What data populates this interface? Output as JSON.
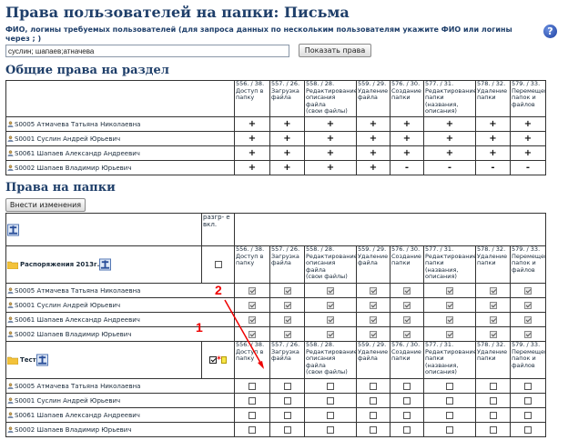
{
  "page_title": "Права пользователей на папки: Письма",
  "search": {
    "description": "ФИО, логины требуемых пользователей (для запроса данных по нескольким пользователям укажите ФИО или логины через ; )",
    "value": "суслин; шапаев;атначева",
    "button": "Показать права"
  },
  "general_section": {
    "title": "Общие права на раздел",
    "columns": [
      [
        "556. / 38.",
        "Доступ в",
        "папку"
      ],
      [
        "557. / 26.",
        "Загрузка",
        "файла"
      ],
      [
        "558. / 28.",
        "Редактирование",
        "описания файла",
        "(свои файлы)"
      ],
      [
        "559. / 29.",
        "Удаление",
        "файла"
      ],
      [
        "576. / 30.",
        "Создание",
        "папки"
      ],
      [
        "577. / 31.",
        "Редактирование",
        "папки (названия,",
        "описания)"
      ],
      [
        "578. / 32.",
        "Удаление",
        "папки"
      ],
      [
        "579. / 33.",
        "Перемещение",
        "папок и",
        "файлов"
      ]
    ],
    "rows": [
      {
        "user": "S0005 Атмачева Татьяна Николаевна",
        "cells": [
          "+",
          "+",
          "+",
          "+",
          "+",
          "+",
          "+",
          "+"
        ]
      },
      {
        "user": "S0001 Суслин Андрей Юрьевич",
        "cells": [
          "+",
          "+",
          "+",
          "+",
          "+",
          "+",
          "+",
          "+"
        ]
      },
      {
        "user": "S0061 Шапаев Александр Андреевич",
        "cells": [
          "+",
          "+",
          "+",
          "+",
          "+",
          "+",
          "+",
          "+"
        ]
      },
      {
        "user": "S0002 Шапаев Владимир Юрьевич",
        "cells": [
          "+",
          "+",
          "+",
          "+",
          "-",
          "-",
          "-",
          "-"
        ]
      }
    ]
  },
  "folders_section": {
    "title": "Права на папки",
    "apply_button": "Внести изменения",
    "enable_header": "разгр- е вкл.",
    "columns": [
      [
        "556. / 38.",
        "Доступ в",
        "папку"
      ],
      [
        "557. / 26.",
        "Загрузка",
        "файла"
      ],
      [
        "558. / 28.",
        "Редактирование",
        "описания файла",
        "(свои файлы)"
      ],
      [
        "559. / 29.",
        "Удаление",
        "файла"
      ],
      [
        "576. / 30.",
        "Создание",
        "папки"
      ],
      [
        "577. / 31.",
        "Редактирование",
        "папки (названия,",
        "описания)"
      ],
      [
        "578. / 32.",
        "Удаление",
        "папки"
      ],
      [
        "579. / 33.",
        "Перемещение",
        "папок и",
        "файлов"
      ]
    ],
    "folders": [
      {
        "name": "Распоряжения 2013г.",
        "enabled": false,
        "users": [
          {
            "user": "S0005 Атмачева Татьяна Николаевна",
            "checked": true
          },
          {
            "user": "S0001 Суслин Андрей Юрьевич",
            "checked": true
          },
          {
            "user": "S0061 Шапаев Александр Андреевич",
            "checked": true
          },
          {
            "user": "S0002 Шапаев Владимир Юрьевич",
            "checked": true
          }
        ]
      },
      {
        "name": "Тест",
        "enabled": true,
        "users": [
          {
            "user": "S0005 Атмачева Татьяна Николаевна",
            "checked": false
          },
          {
            "user": "S0001 Суслин Андрей Юрьевич",
            "checked": false
          },
          {
            "user": "S0061 Шапаев Александр Андреевич",
            "checked": false
          },
          {
            "user": "S0002 Шапаев Владимир Юрьевич",
            "checked": false
          }
        ]
      }
    ]
  },
  "annotations": {
    "marker_1": "1",
    "marker_2": "2"
  },
  "colors": {
    "accent": "#1f3f6a",
    "annotation": "#e00000"
  }
}
